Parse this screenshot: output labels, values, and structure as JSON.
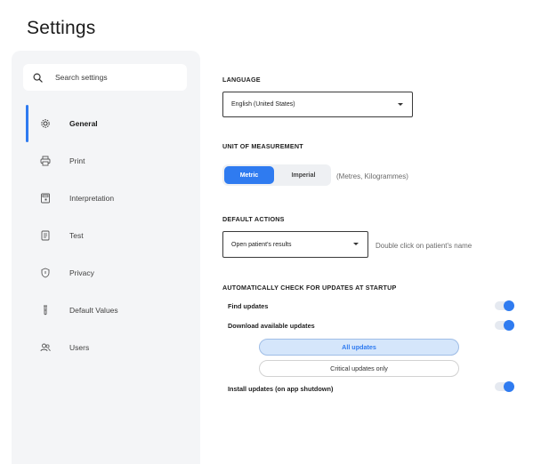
{
  "page": {
    "title": "Settings"
  },
  "search": {
    "placeholder": "Search settings"
  },
  "sidebar": {
    "items": [
      {
        "label": "General",
        "icon": "gear-icon",
        "active": true
      },
      {
        "label": "Print",
        "icon": "printer-icon"
      },
      {
        "label": "Interpretation",
        "icon": "calculator-icon"
      },
      {
        "label": "Test",
        "icon": "document-icon"
      },
      {
        "label": "Privacy",
        "icon": "shield-icon"
      },
      {
        "label": "Default Values",
        "icon": "test-tube-icon"
      },
      {
        "label": "Users",
        "icon": "users-icon"
      }
    ]
  },
  "language": {
    "title": "LANGUAGE",
    "value": "English (United States)"
  },
  "unit": {
    "title": "UNIT OF MEASUREMENT",
    "options": [
      "Metric",
      "Imperial"
    ],
    "selected": "Metric",
    "hint": "(Metres, Kilogrammes)"
  },
  "default_actions": {
    "title": "DEFAULT ACTIONS",
    "value": "Open patient's results",
    "hint": "Double click on patient's name"
  },
  "updates": {
    "title": "AUTOMATICALLY CHECK FOR UPDATES AT STARTUP",
    "find_label": "Find updates",
    "find_on": true,
    "download_label": "Download available updates",
    "download_on": true,
    "options": [
      "All updates",
      "Critical updates only"
    ],
    "selected": "All updates",
    "install_label": "Install updates (on app shutdown)",
    "install_on": true
  },
  "colors": {
    "accent": "#2f7bf0",
    "sidebar_bg": "#f4f5f7",
    "selected_option_bg": "#d5e6fb"
  }
}
